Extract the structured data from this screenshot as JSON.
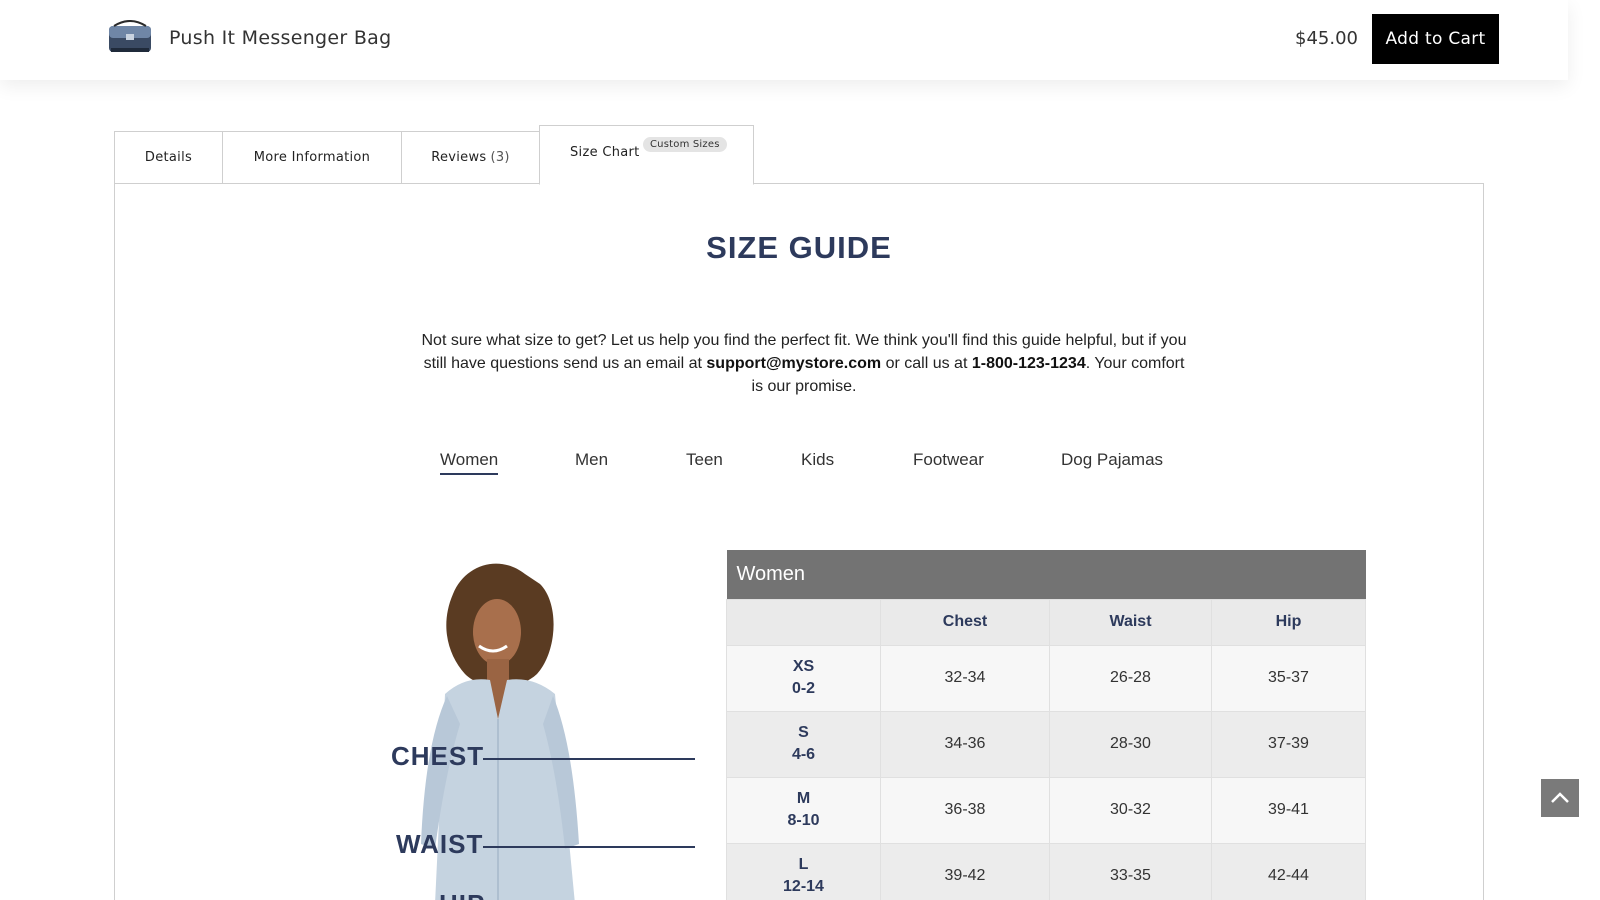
{
  "sticky_bar": {
    "product_name": "Push It Messenger Bag",
    "price": "$45.00",
    "add_to_cart_label": "Add to Cart",
    "thumbnail_icon": "messenger-bag-icon"
  },
  "tabs": [
    {
      "label": "Details",
      "count": ""
    },
    {
      "label": "More Information",
      "count": ""
    },
    {
      "label": "Reviews",
      "count": "(3)"
    },
    {
      "label": "Size Chart",
      "badge": "Custom Sizes",
      "active": true
    }
  ],
  "size_guide": {
    "title": "SIZE GUIDE",
    "intro_part1": "Not sure what size to get? Let us help you find the perfect fit. We think you'll find this guide helpful, but if you still have questions send us an email at ",
    "email": "support@mystore.com",
    "intro_part2": " or call us at ",
    "phone": "1-800-123-1234",
    "intro_part3": ". Your comfort is our promise.",
    "categories": [
      "Women",
      "Men",
      "Teen",
      "Kids",
      "Footwear",
      "Dog Pajamas"
    ],
    "active_category": "Women",
    "figure_labels": {
      "chest": "CHEST",
      "waist": "WAIST",
      "hip": "HIP"
    },
    "table": {
      "title": "Women",
      "columns": [
        "",
        "Chest",
        "Waist",
        "Hip"
      ],
      "rows": [
        {
          "size": "XS",
          "range": "0-2",
          "chest": "32-34",
          "waist": "26-28",
          "hip": "35-37"
        },
        {
          "size": "S",
          "range": "4-6",
          "chest": "34-36",
          "waist": "28-30",
          "hip": "37-39"
        },
        {
          "size": "M",
          "range": "8-10",
          "chest": "36-38",
          "waist": "30-32",
          "hip": "39-41"
        },
        {
          "size": "L",
          "range": "12-14",
          "chest": "39-42",
          "waist": "33-35",
          "hip": "42-44"
        }
      ]
    }
  },
  "scroll_top_icon": "chevron-up-icon",
  "colors": {
    "accent": "#2d3a5c",
    "button": "#000000",
    "table_header": "#737373"
  }
}
